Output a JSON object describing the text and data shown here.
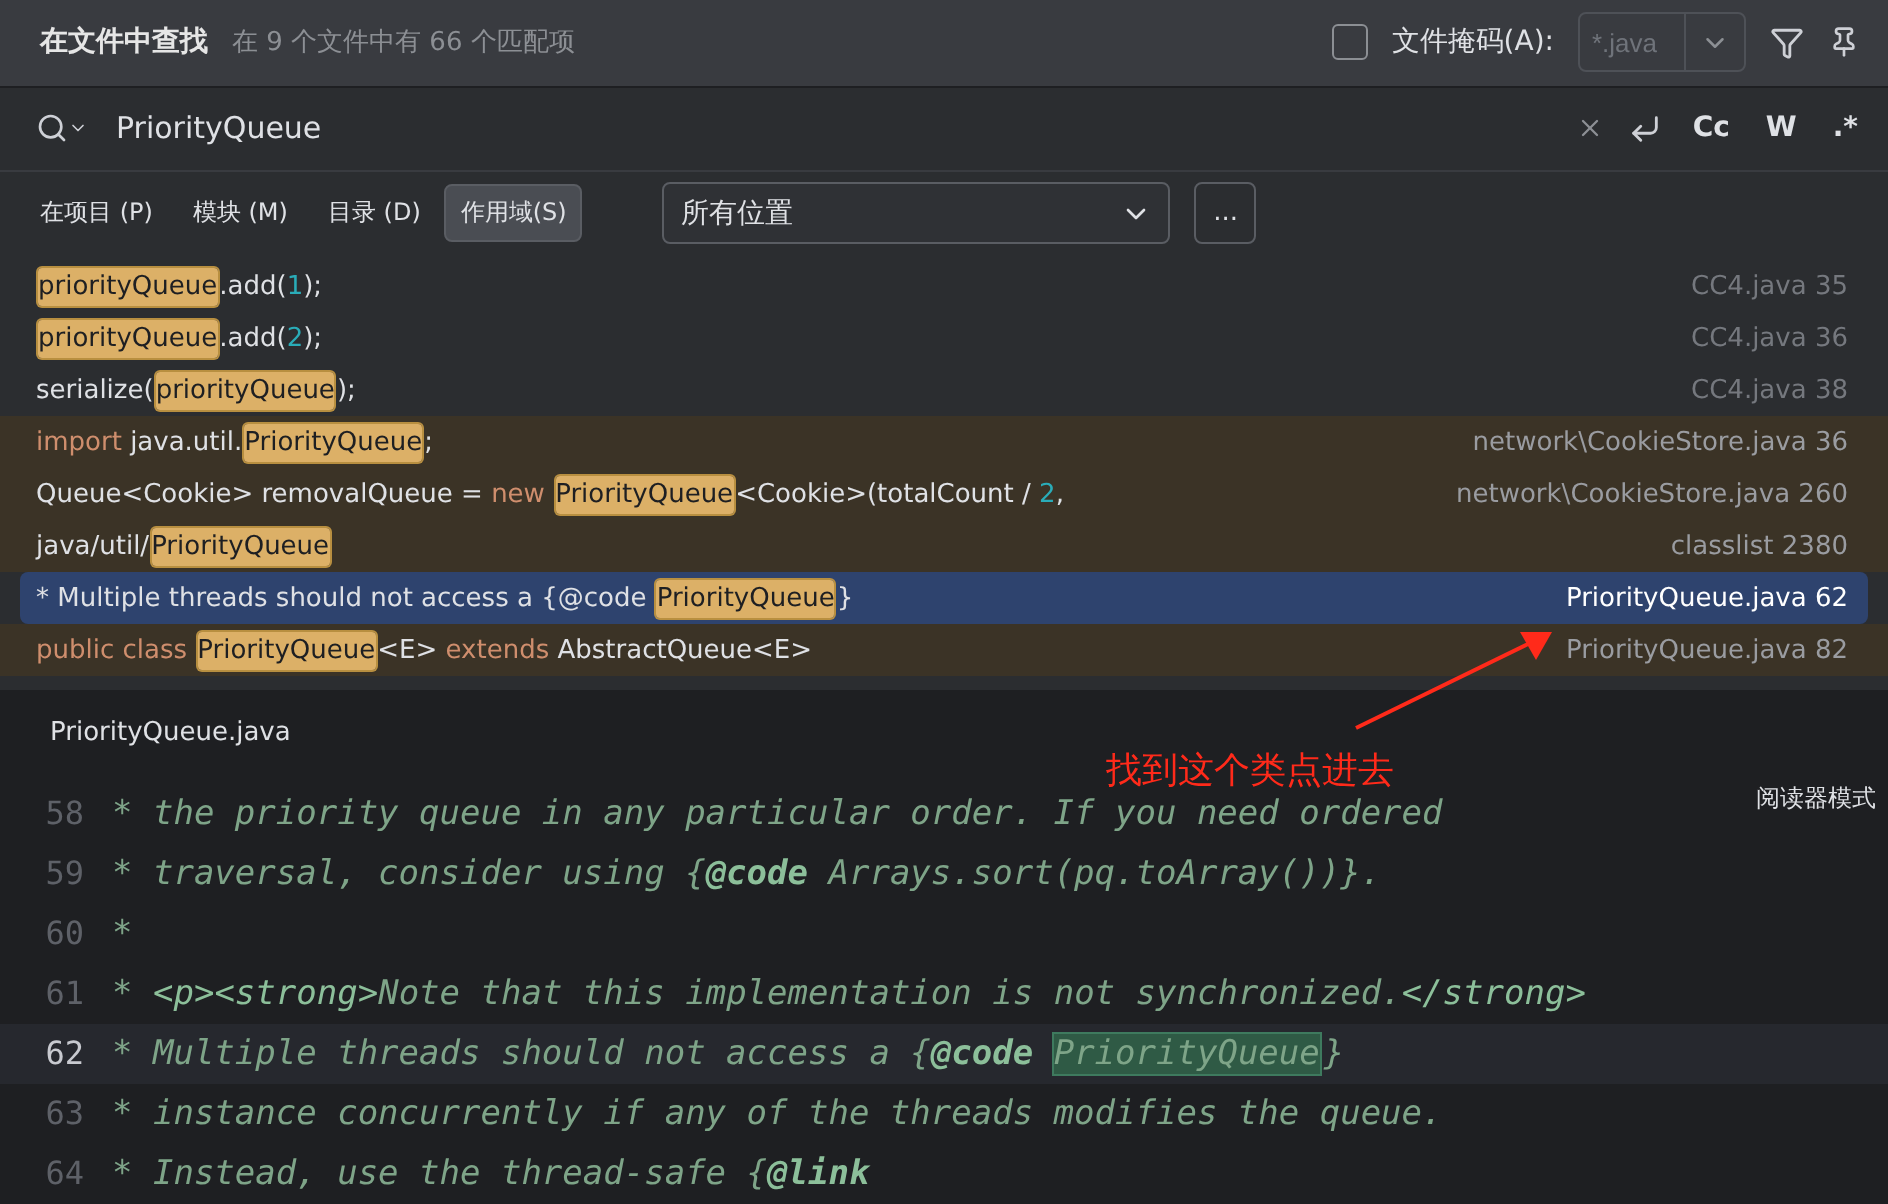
{
  "header": {
    "title": "在文件中查找",
    "summary": "在 9 个文件中有 66 个匹配项",
    "file_mask": {
      "label": "文件掩码(A):",
      "checked": false,
      "placeholder": "*.java"
    }
  },
  "search": {
    "value": "PriorityQueue",
    "options": [
      "Cc",
      "W",
      ".*"
    ]
  },
  "scopes": [
    {
      "label": "在项目 (P)",
      "selected": false
    },
    {
      "label": "模块 (M)",
      "selected": false
    },
    {
      "label": "目录 (D)",
      "selected": false
    },
    {
      "label": "作用域(S)",
      "selected": true
    }
  ],
  "location": {
    "value": "所有位置",
    "more_button": "..."
  },
  "results": [
    {
      "kind": "project",
      "selected": false,
      "file": "CC4.java 35",
      "segments": [
        {
          "kind": "match",
          "text": "priorityQueue"
        },
        {
          "kind": "plain",
          "text": ".add("
        },
        {
          "kind": "number",
          "text": "1"
        },
        {
          "kind": "plain",
          "text": ");"
        }
      ]
    },
    {
      "kind": "project",
      "selected": false,
      "file": "CC4.java 36",
      "segments": [
        {
          "kind": "match",
          "text": "priorityQueue"
        },
        {
          "kind": "plain",
          "text": ".add("
        },
        {
          "kind": "number",
          "text": "2"
        },
        {
          "kind": "plain",
          "text": ");"
        }
      ]
    },
    {
      "kind": "project",
      "selected": false,
      "file": "CC4.java 38",
      "segments": [
        {
          "kind": "plain",
          "text": "serialize("
        },
        {
          "kind": "match",
          "text": "priorityQueue"
        },
        {
          "kind": "plain",
          "text": ");"
        }
      ]
    },
    {
      "kind": "library",
      "selected": false,
      "file": "network\\CookieStore.java 36",
      "segments": [
        {
          "kind": "keyword",
          "text": "import "
        },
        {
          "kind": "plain",
          "text": "java.util."
        },
        {
          "kind": "match",
          "text": "PriorityQueue"
        },
        {
          "kind": "plain",
          "text": ";"
        }
      ]
    },
    {
      "kind": "library",
      "selected": false,
      "file": "network\\CookieStore.java 260",
      "segments": [
        {
          "kind": "plain",
          "text": "Queue<Cookie> removalQueue = "
        },
        {
          "kind": "keyword",
          "text": "new "
        },
        {
          "kind": "match",
          "text": "PriorityQueue"
        },
        {
          "kind": "plain",
          "text": "<Cookie>(totalCount / "
        },
        {
          "kind": "number",
          "text": "2"
        },
        {
          "kind": "plain",
          "text": ","
        }
      ]
    },
    {
      "kind": "library",
      "selected": false,
      "file": "classlist 2380",
      "segments": [
        {
          "kind": "plain",
          "text": "java/util/"
        },
        {
          "kind": "match",
          "text": "PriorityQueue"
        }
      ]
    },
    {
      "kind": "library",
      "selected": true,
      "file": "PriorityQueue.java 62",
      "segments": [
        {
          "kind": "plain",
          "text": "* Multiple threads should not access a {@code "
        },
        {
          "kind": "match",
          "text": "PriorityQueue"
        },
        {
          "kind": "plain",
          "text": "}"
        }
      ]
    },
    {
      "kind": "library",
      "selected": false,
      "file": "PriorityQueue.java 82",
      "segments": [
        {
          "kind": "keyword",
          "text": "public class "
        },
        {
          "kind": "match",
          "text": "PriorityQueue"
        },
        {
          "kind": "plain",
          "text": "<E> "
        },
        {
          "kind": "keyword",
          "text": "extends "
        },
        {
          "kind": "plain",
          "text": "AbstractQueue<E>"
        }
      ]
    }
  ],
  "editor": {
    "tab": "PriorityQueue.java",
    "reader_mode": "阅读器模式",
    "lines": [
      {
        "number": "58",
        "current": false,
        "segments": [
          {
            "kind": "comment",
            "text": "* the priority queue in any particular order. If you need ordered"
          }
        ]
      },
      {
        "number": "59",
        "current": false,
        "segments": [
          {
            "kind": "comment",
            "text": "* traversal, consider using {"
          },
          {
            "kind": "doctag",
            "text": "@code"
          },
          {
            "kind": "comment",
            "text": " Arrays.sort(pq.toArray())}."
          }
        ]
      },
      {
        "number": "60",
        "current": false,
        "segments": [
          {
            "kind": "comment",
            "text": "*"
          }
        ]
      },
      {
        "number": "61",
        "current": false,
        "segments": [
          {
            "kind": "comment",
            "text": "* "
          },
          {
            "kind": "tag",
            "text": "<p><strong>"
          },
          {
            "kind": "comment",
            "text": "Note that this implementation is not synchronized."
          },
          {
            "kind": "tag",
            "text": "</strong>"
          }
        ]
      },
      {
        "number": "62",
        "current": true,
        "segments": [
          {
            "kind": "comment",
            "text": "* Multiple threads should not access a {"
          },
          {
            "kind": "doctag",
            "text": "@code "
          },
          {
            "kind": "match",
            "text": "PriorityQueue"
          },
          {
            "kind": "comment",
            "text": "}"
          }
        ]
      },
      {
        "number": "63",
        "current": false,
        "segments": [
          {
            "kind": "comment",
            "text": "* instance concurrently if any of the threads modifies the queue."
          }
        ]
      },
      {
        "number": "64",
        "current": false,
        "segments": [
          {
            "kind": "comment",
            "text": "* Instead, use the thread-safe {"
          },
          {
            "kind": "doctag",
            "text": "@link"
          }
        ]
      }
    ]
  },
  "annotation": {
    "text": "找到这个类点进去"
  }
}
